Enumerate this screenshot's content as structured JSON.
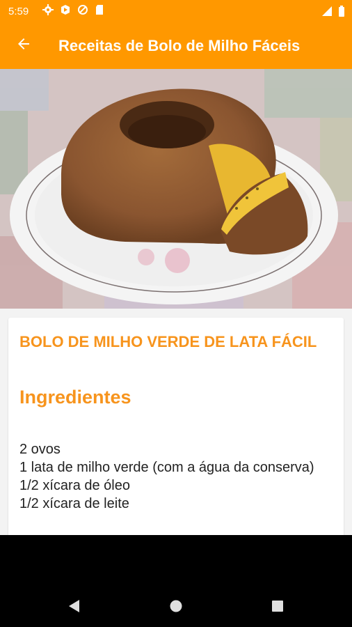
{
  "status": {
    "time": "5:59",
    "icons": [
      "gear-icon",
      "play-icon",
      "no-sign-icon",
      "sd-card-icon"
    ],
    "right_icons": [
      "signal-icon",
      "battery-icon"
    ]
  },
  "appbar": {
    "title": "Receitas de Bolo de Milho Fáceis",
    "back_icon": "arrow-left-icon"
  },
  "recipe": {
    "title": "BOLO DE MILHO VERDE DE LATA FÁCIL",
    "section": "Ingredientes",
    "ingredients": [
      "2 ovos",
      "1 lata de milho verde (com a água da conserva)",
      "1/2 xícara de óleo",
      "1/2 xícara de leite"
    ]
  },
  "colors": {
    "accent": "#ff9800",
    "title_orange": "#f7941d"
  },
  "navbar": [
    "back-triangle-icon",
    "home-circle-icon",
    "recent-square-icon"
  ]
}
